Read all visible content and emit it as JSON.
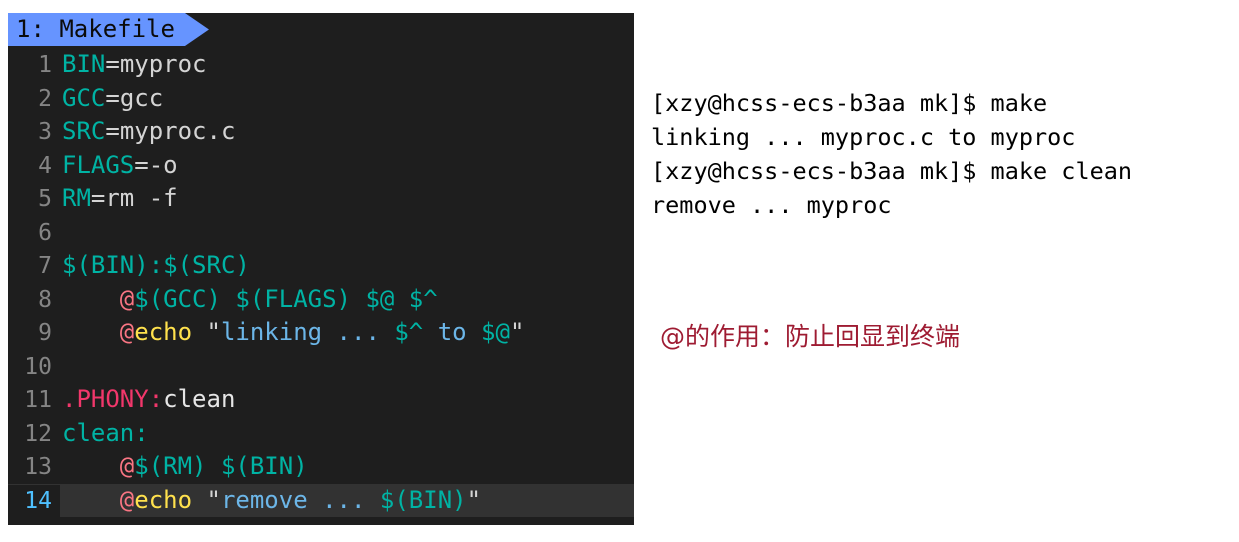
{
  "editor": {
    "tab": {
      "label": "1: Makefile",
      "background": "#6694ff",
      "text_color": "#0b0b0b"
    },
    "background": "#1e1e1e",
    "active_line": 14,
    "active_line_bg": "#323232",
    "active_line_number_color": "#4fc1ff",
    "gutter_color": "#858585",
    "lines": [
      {
        "number": "1",
        "tokens": [
          {
            "text": "BIN",
            "cls": "t-var"
          },
          {
            "text": "=",
            "cls": "t-eq"
          },
          {
            "text": "myproc",
            "cls": "t-val"
          }
        ]
      },
      {
        "number": "2",
        "tokens": [
          {
            "text": "GCC",
            "cls": "t-var"
          },
          {
            "text": "=",
            "cls": "t-eq"
          },
          {
            "text": "gcc",
            "cls": "t-val"
          }
        ]
      },
      {
        "number": "3",
        "tokens": [
          {
            "text": "SRC",
            "cls": "t-var"
          },
          {
            "text": "=",
            "cls": "t-eq"
          },
          {
            "text": "myproc.c",
            "cls": "t-val"
          }
        ]
      },
      {
        "number": "4",
        "tokens": [
          {
            "text": "FLAGS",
            "cls": "t-var"
          },
          {
            "text": "=",
            "cls": "t-eq"
          },
          {
            "text": "-o",
            "cls": "t-val"
          }
        ]
      },
      {
        "number": "5",
        "tokens": [
          {
            "text": "RM",
            "cls": "t-var"
          },
          {
            "text": "=",
            "cls": "t-eq"
          },
          {
            "text": "rm -f",
            "cls": "t-val"
          }
        ]
      },
      {
        "number": "6",
        "tokens": []
      },
      {
        "number": "7",
        "tokens": [
          {
            "text": "$(BIN):$(SRC)",
            "cls": "t-var"
          }
        ]
      },
      {
        "number": "8",
        "tokens": [
          {
            "text": "    ",
            "cls": "t-val"
          },
          {
            "text": "@",
            "cls": "t-at"
          },
          {
            "text": "$(GCC) $(FLAGS) $@ $^",
            "cls": "t-var"
          }
        ]
      },
      {
        "number": "9",
        "tokens": [
          {
            "text": "    ",
            "cls": "t-val"
          },
          {
            "text": "@",
            "cls": "t-at"
          },
          {
            "text": "echo",
            "cls": "t-kw"
          },
          {
            "text": " ",
            "cls": "t-val"
          },
          {
            "text": "\"",
            "cls": "t-quote"
          },
          {
            "text": "linking ... ",
            "cls": "t-str"
          },
          {
            "text": "$^",
            "cls": "t-var"
          },
          {
            "text": " to ",
            "cls": "t-str"
          },
          {
            "text": "$@",
            "cls": "t-var"
          },
          {
            "text": "\"",
            "cls": "t-quote"
          }
        ]
      },
      {
        "number": "10",
        "tokens": []
      },
      {
        "number": "11",
        "tokens": [
          {
            "text": ".PHONY",
            "cls": "t-dot"
          },
          {
            "text": ":",
            "cls": "t-colon"
          },
          {
            "text": "clean",
            "cls": "t-white"
          }
        ]
      },
      {
        "number": "12",
        "tokens": [
          {
            "text": "clean:",
            "cls": "t-var"
          }
        ]
      },
      {
        "number": "13",
        "tokens": [
          {
            "text": "    ",
            "cls": "t-val"
          },
          {
            "text": "@",
            "cls": "t-at"
          },
          {
            "text": "$(RM) $(BIN)",
            "cls": "t-var"
          }
        ]
      },
      {
        "number": "14",
        "tokens": [
          {
            "text": "    ",
            "cls": "t-val"
          },
          {
            "text": "@",
            "cls": "t-at"
          },
          {
            "text": "echo",
            "cls": "t-kw"
          },
          {
            "text": " ",
            "cls": "t-val"
          },
          {
            "text": "\"",
            "cls": "t-quote"
          },
          {
            "text": "remove ... ",
            "cls": "t-str"
          },
          {
            "text": "$(BIN)",
            "cls": "t-var"
          },
          {
            "text": "\"",
            "cls": "t-quote"
          }
        ]
      }
    ]
  },
  "terminal": {
    "text_color": "#000000",
    "background": "#ffffff",
    "lines": [
      "[xzy@hcss-ecs-b3aa mk]$ make",
      "linking ... myproc.c to myproc",
      "[xzy@hcss-ecs-b3aa mk]$ make clean",
      "remove ... myproc"
    ]
  },
  "annotation": {
    "text": "@的作用：防止回显到终端",
    "color": "#9e1b32"
  }
}
